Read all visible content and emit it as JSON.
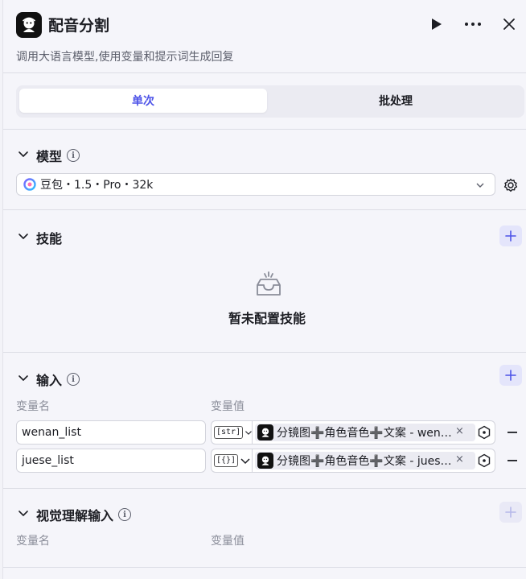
{
  "header": {
    "title": "配音分割",
    "description": "调用大语言模型,使用变量和提示词生成回复"
  },
  "tabs": [
    {
      "label": "单次",
      "active": true
    },
    {
      "label": "批处理",
      "active": false
    }
  ],
  "model_section": {
    "title": "模型",
    "selected_model": "豆包・1.5・Pro・32k"
  },
  "skills_section": {
    "title": "技能",
    "empty_text": "暂未配置技能"
  },
  "input_section": {
    "title": "输入",
    "col_name": "变量名",
    "col_value": "变量值",
    "rows": [
      {
        "name": "wenan_list",
        "type_badge": "[str]",
        "ref": "分镜图➕角色音色➕文案 - wenan_list",
        "remove": "×"
      },
      {
        "name": "juese_list",
        "type_badge": "[{}]",
        "ref": "分镜图➕角色音色➕文案 - juese_list",
        "remove": "×"
      }
    ]
  },
  "vision_section": {
    "title": "视觉理解输入",
    "col_name": "变量名",
    "col_value": "变量值"
  },
  "colors": {
    "accent": "#4d53e8",
    "panel_bg": "#f5f5fa"
  }
}
